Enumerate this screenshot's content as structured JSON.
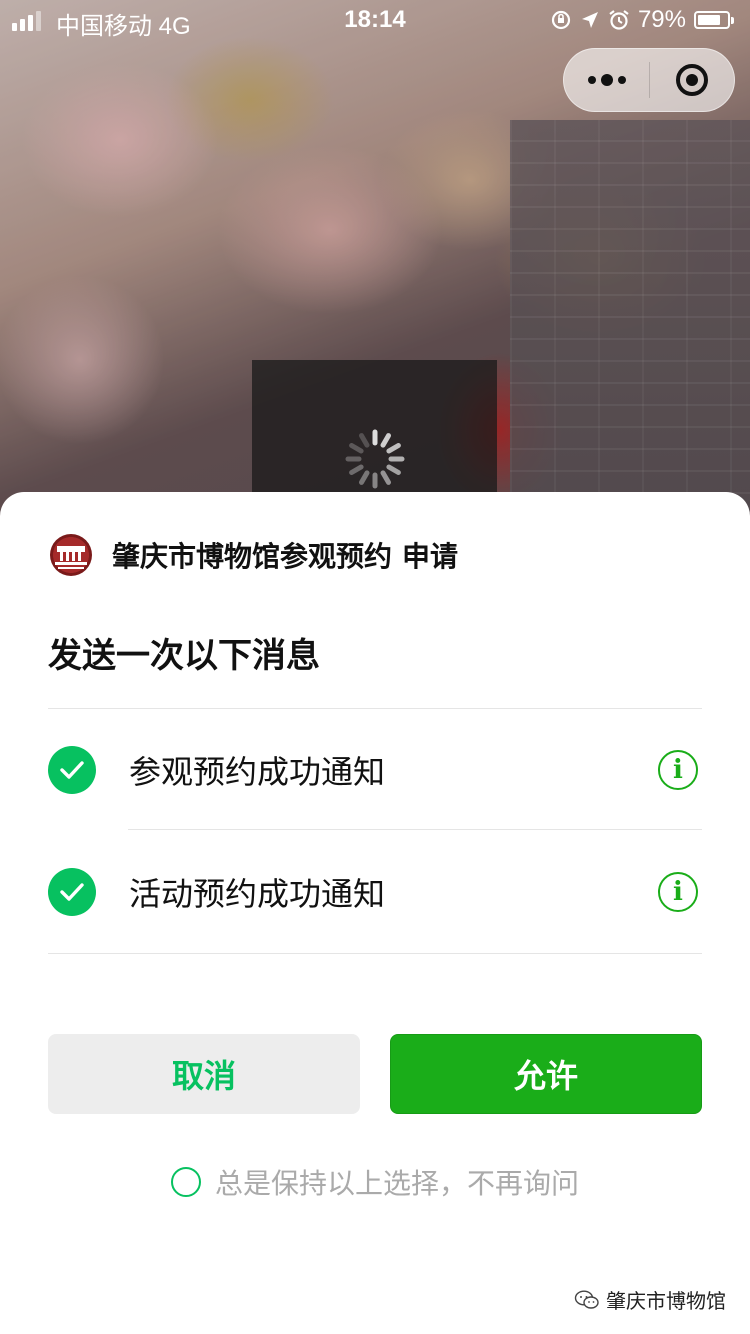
{
  "status_bar": {
    "carrier": "中国移动  4G",
    "time": "18:14",
    "battery_percent": "79%",
    "battery_level": 0.79
  },
  "background": {
    "loading": true
  },
  "sheet": {
    "app_name": "肇庆市博物馆参观预约",
    "request_verb": "申请",
    "title": "发送一次以下消息",
    "options": [
      {
        "label": "参观预约成功通知",
        "checked": true
      },
      {
        "label": "活动预约成功通知",
        "checked": true
      }
    ],
    "cancel_label": "取消",
    "allow_label": "允许",
    "remember_label": "总是保持以上选择，不再询问"
  },
  "watermark": {
    "text": "肇庆市博物馆"
  },
  "colors": {
    "accent_green": "#07c160",
    "allow_button": "#1aad19",
    "cancel_button_bg": "#ededed"
  }
}
